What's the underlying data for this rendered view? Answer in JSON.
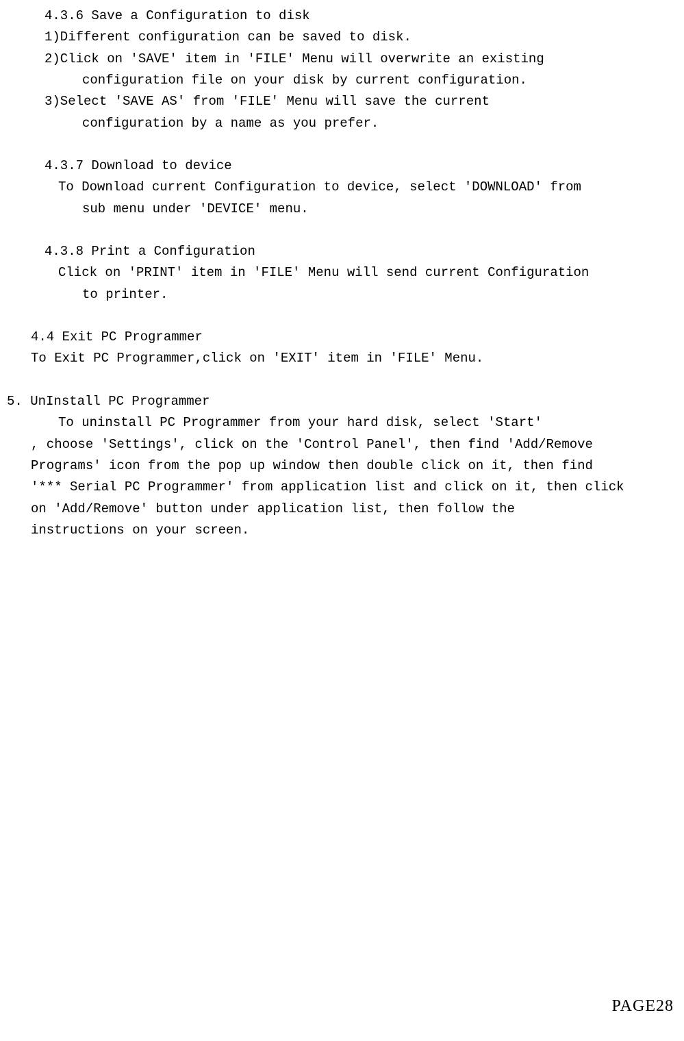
{
  "sections": {
    "s436": {
      "heading": "4.3.6 Save a Configuration to disk",
      "line1": "1)Different configuration can be saved to disk.",
      "line2": "2)Click on 'SAVE' item in 'FILE' Menu will overwrite an existing",
      "line2b": "configuration file on your disk by current configuration.",
      "line3": "3)Select 'SAVE AS' from 'FILE' Menu will save the current",
      "line3b": "configuration by  a name as you prefer."
    },
    "s437": {
      "heading": "4.3.7 Download to device",
      "line1": "To Download current Configuration to device, select 'DOWNLOAD' from",
      "line1b": "sub menu under 'DEVICE' menu."
    },
    "s438": {
      "heading": "4.3.8 Print a Configuration",
      "line1": "Click on 'PRINT' item in 'FILE' Menu will send current Configuration",
      "line1b": "to printer."
    },
    "s44": {
      "heading": "4.4 Exit PC Programmer",
      "line1": "To Exit PC Programmer,click on 'EXIT' item in 'FILE' Menu."
    },
    "s5": {
      "heading": "5.  UnInstall PC Programmer",
      "line1": "To uninstall PC Programmer from your hard disk,  select 'Start'",
      "line2": ", choose 'Settings', click on the 'Control Panel', then find 'Add/Remove",
      "line3": "Programs' icon from the pop up window then double click on it, then find",
      "line4": "'*** Serial PC Programmer' from application list and click on it, then click",
      "line5": "on 'Add/Remove' button under application list, then follow the",
      "line6": "instructions on your screen."
    }
  },
  "pageNumber": "PAGE28"
}
